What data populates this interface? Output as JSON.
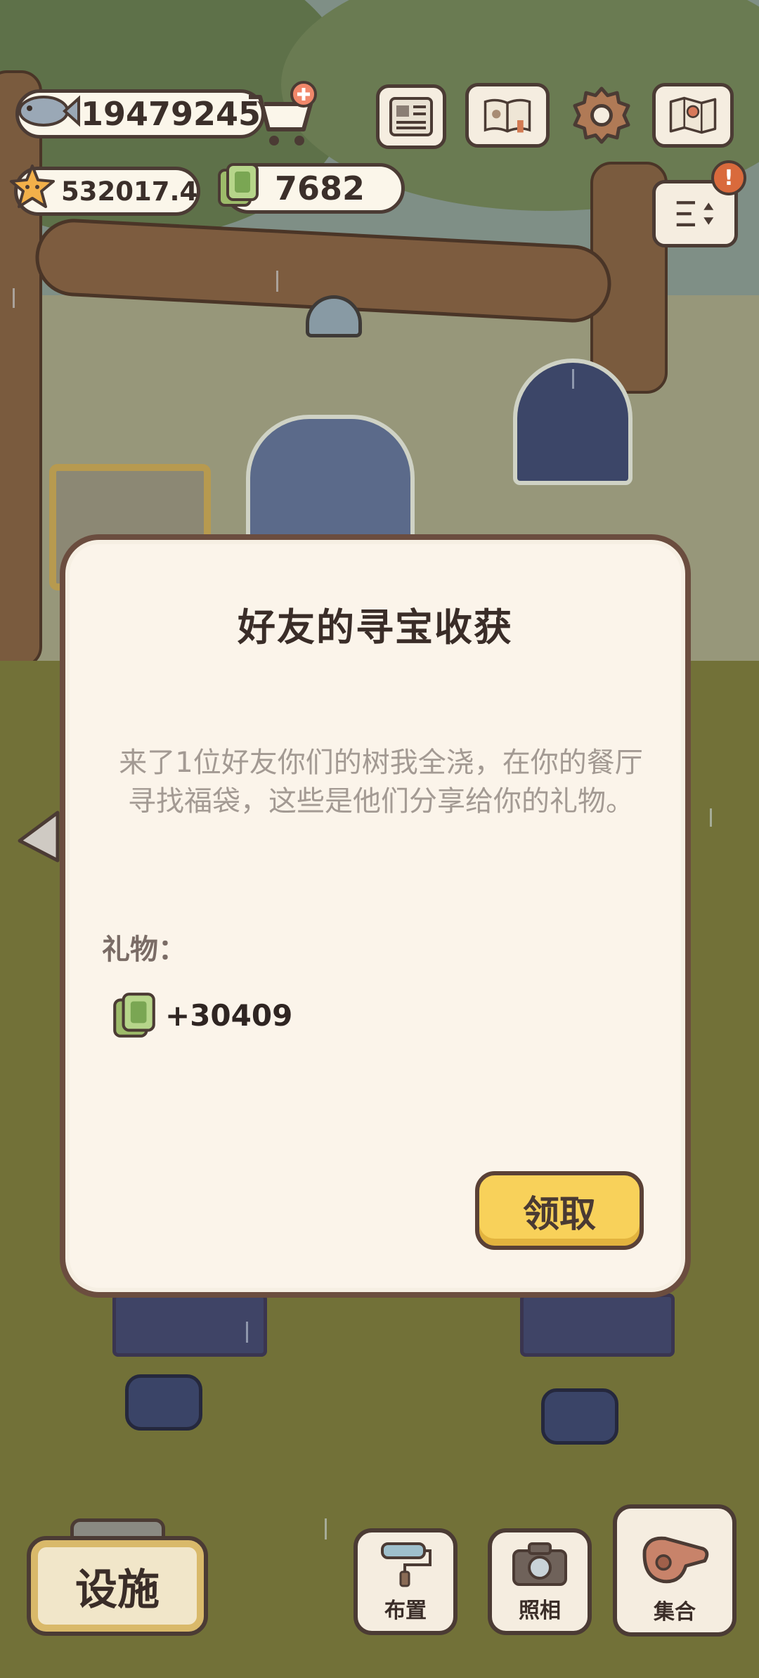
{
  "hud": {
    "fish_coins": "19479245",
    "stars": "532017.4",
    "leaf_tickets": "7682",
    "alert_badge": "!"
  },
  "dialog": {
    "title": "好友的寻宝收获",
    "description": "来了1位好友你们的树我全浇，在你的餐厅寻找福袋，这些是他们分享给你的礼物。",
    "gift_label": "礼物：",
    "gift_amount": "+30409",
    "claim_label": "领取"
  },
  "bottom_bar": {
    "facility_label": "设施",
    "layout_label": "布置",
    "photo_label": "照相",
    "gather_label": "集合"
  },
  "colors": {
    "dialog_bg": "#fbf4ea",
    "dialog_border": "#6b4d3f",
    "claim_button": "#f8d15a",
    "hud_pill": "#fbf6ea"
  },
  "icons": {
    "fish": "fish-icon",
    "star": "star-icon",
    "leaf_ticket": "leaf-ticket-icon",
    "cart": "shopping-cart-plus-icon",
    "newspaper": "newspaper-icon",
    "album": "album-book-icon",
    "settings": "gear-icon",
    "map": "map-icon",
    "sort": "sort-icon",
    "back": "left-arrow-icon",
    "layout": "paint-roller-icon",
    "photo": "camera-icon",
    "gather": "whistle-icon"
  }
}
